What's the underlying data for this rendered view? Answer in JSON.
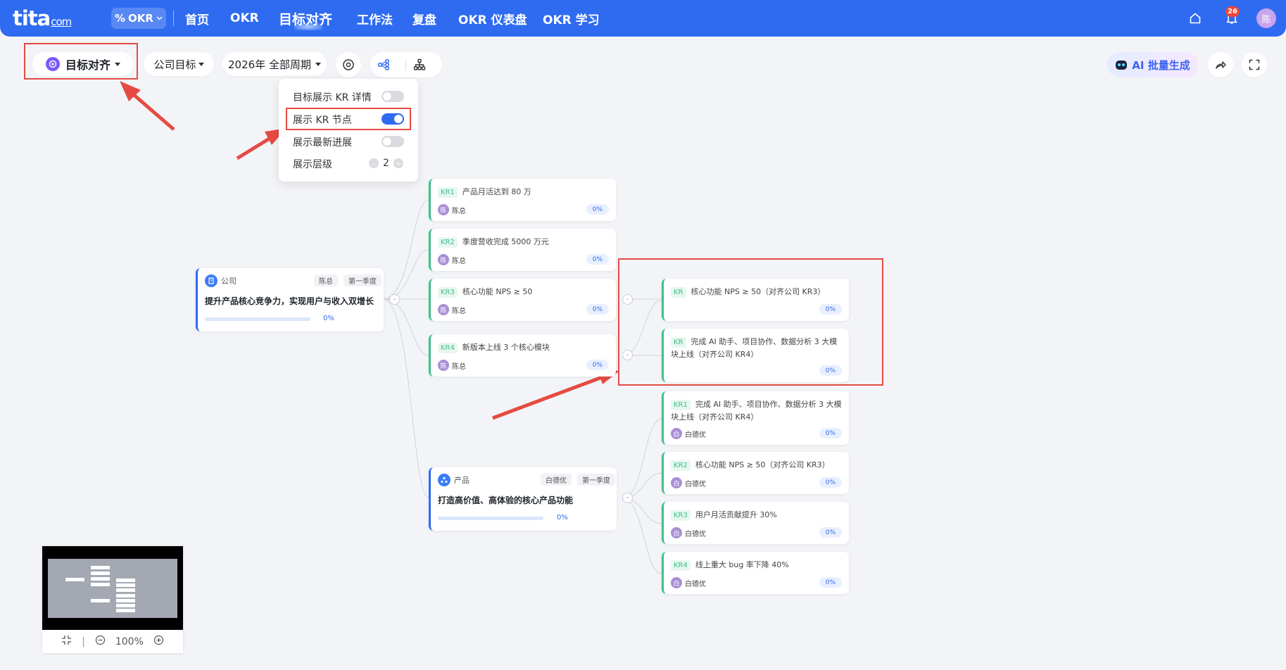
{
  "topbar": {
    "logo_main": "tita",
    "logo_sub": "com",
    "okr_switch": "OKR",
    "nav": [
      "首页",
      "OKR",
      "目标对齐",
      "工作法",
      "复盘",
      "OKR 仪表盘",
      "OKR 学习"
    ],
    "notification_count": "26",
    "user_avatar": "陈"
  },
  "toolbar": {
    "view_label": "目标对齐",
    "scope_label": "公司目标",
    "period_label": "2026年 全部周期",
    "ai_label": "AI 批量生成"
  },
  "settings_popup": {
    "rows": [
      {
        "label": "目标展示 KR 详情",
        "on": false
      },
      {
        "label": "展示 KR 节点",
        "on": true
      },
      {
        "label": "展示最新进展",
        "on": false
      }
    ],
    "level_label": "展示层级",
    "level_minus": "-",
    "level_value": "2",
    "level_plus": "+"
  },
  "company_objective": {
    "type": "公司",
    "owner": "陈总",
    "period": "第一季度",
    "title": "提升产品核心竞争力，实现用户与收入双增长",
    "progress": "0%",
    "krs": [
      {
        "code": "KR1",
        "title": "产品月活达到 80 万",
        "owner_avatar": "陈",
        "owner": "陈总",
        "progress": "0%"
      },
      {
        "code": "KR2",
        "title": "季度营收完成 5000 万元",
        "owner_avatar": "陈",
        "owner": "陈总",
        "progress": "0%"
      },
      {
        "code": "KR3",
        "title": "核心功能 NPS ≥ 50",
        "owner_avatar": "陈",
        "owner": "陈总",
        "progress": "0%"
      },
      {
        "code": "KR4",
        "title": "新版本上线 3 个核心模块",
        "owner_avatar": "陈",
        "owner": "陈总",
        "progress": "0%"
      }
    ]
  },
  "aligned_krs": [
    {
      "code": "KR",
      "title": "核心功能 NPS ≥ 50（对齐公司 KR3）",
      "progress": "0%"
    },
    {
      "code": "KR",
      "title": "完成 AI 助手、项目协作、数据分析 3 大模块上线（对齐公司 KR4）",
      "progress": "0%"
    }
  ],
  "product_objective": {
    "type": "产品",
    "owner": "白德优",
    "period": "第一季度",
    "title": "打造高价值、高体验的核心产品功能",
    "progress": "0%",
    "krs": [
      {
        "code": "KR1",
        "title": "完成 AI 助手、项目协作、数据分析 3 大模块上线（对齐公司 KR4）",
        "owner_avatar": "白",
        "owner": "白德优",
        "progress": "0%"
      },
      {
        "code": "KR2",
        "title": "核心功能 NPS ≥ 50（对齐公司 KR3）",
        "owner_avatar": "白",
        "owner": "白德优",
        "progress": "0%"
      },
      {
        "code": "KR3",
        "title": "用户月活贡献提升 30%",
        "owner_avatar": "白",
        "owner": "白德优",
        "progress": "0%"
      },
      {
        "code": "KR4",
        "title": "线上重大 bug 率下降 40%",
        "owner_avatar": "白",
        "owner": "白德优",
        "progress": "0%"
      }
    ]
  },
  "collapse_symbol": "-",
  "minimap": {
    "zoom": "100%",
    "separator": "|"
  },
  "colors": {
    "brand": "#2f6bf1",
    "kr_green": "#3dc08a",
    "annotation_red": "#e54b43"
  }
}
